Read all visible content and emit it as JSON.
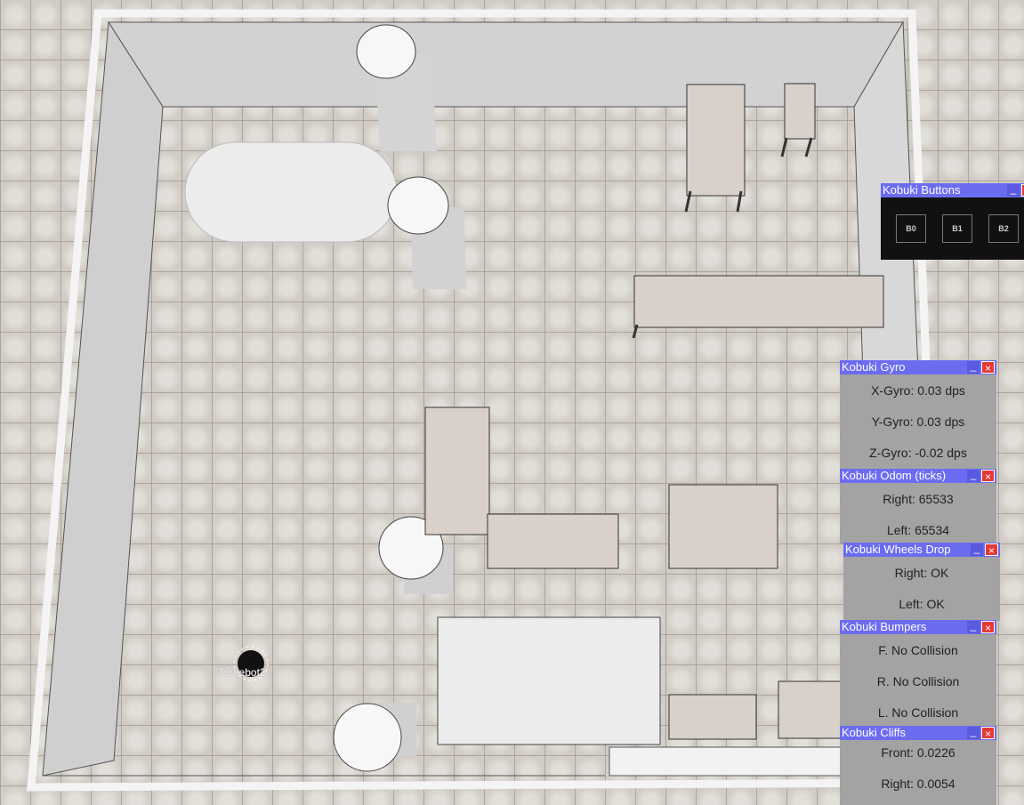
{
  "robot": {
    "label": "Turtlebot2"
  },
  "panels": {
    "buttons": {
      "title": "Kobuki Buttons",
      "min_icon": "minimize-icon",
      "close_icon": "close-icon",
      "items": [
        {
          "label": "B0"
        },
        {
          "label": "B1"
        },
        {
          "label": "B2"
        }
      ]
    },
    "gyro": {
      "title": "Kobuki Gyro",
      "x": "X-Gyro: 0.03 dps",
      "y": "Y-Gyro: 0.03 dps",
      "z": "Z-Gyro: -0.02 dps"
    },
    "odom": {
      "title": "Kobuki Odom (ticks)",
      "right": "Right: 65533",
      "left": "Left: 65534"
    },
    "wheels": {
      "title": "Kobuki Wheels Drop",
      "right": "Right: OK",
      "left": "Left: OK"
    },
    "bumpers": {
      "title": "Kobuki Bumpers",
      "front": "F. No Collision",
      "right": "R. No Collision",
      "left": "L. No Collision"
    },
    "cliffs": {
      "title": "Kobuki Cliffs",
      "front": "Front: 0.0226",
      "right": "Right: 0.0054"
    }
  },
  "colors": {
    "titlebar": "#6c6cf0",
    "close": "#e53935",
    "panel_bg": "#a3a3a3"
  }
}
